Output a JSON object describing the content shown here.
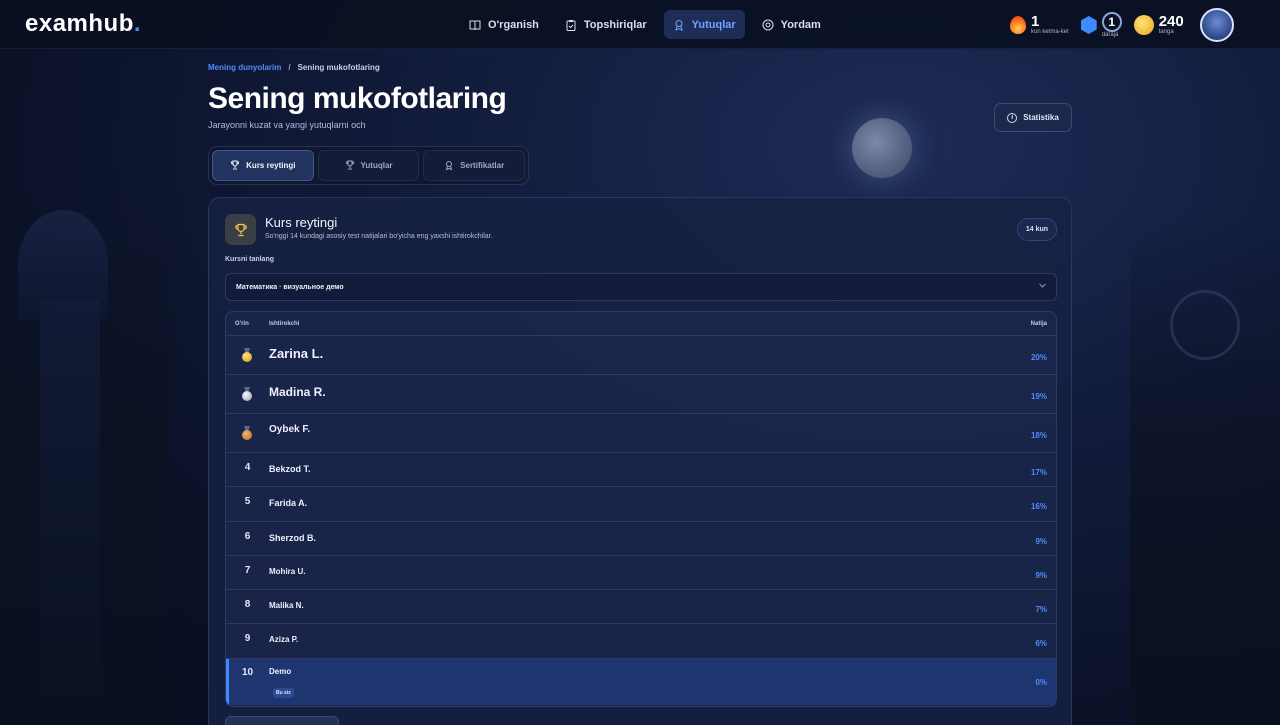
{
  "brand": {
    "logo": "examhub",
    "logo_dot": "."
  },
  "nav": [
    {
      "label": "O'rganish",
      "icon": "book-icon"
    },
    {
      "label": "Topshiriqlar",
      "icon": "clipboard-icon"
    },
    {
      "label": "Yutuqlar",
      "icon": "award-icon",
      "active": true
    },
    {
      "label": "Yordam",
      "icon": "help-icon"
    }
  ],
  "stats": {
    "streak_value": "1",
    "streak_label": "kun ketma-ket",
    "level_value": "1",
    "level_label": "daraja",
    "coins_value": "240",
    "coins_label": "tanga"
  },
  "breadcrumb": {
    "parent": "Mening dunyolarim",
    "separator": "/",
    "current": "Sening mukofotlaring"
  },
  "page": {
    "title": "Sening mukofotlaring",
    "subtitle": "Jarayonni kuzat va yangi yutuqlarni och",
    "stats_button": "Statistika"
  },
  "tabs": [
    {
      "label": "Kurs reytingi",
      "active": true
    },
    {
      "label": "Yutuqlar"
    },
    {
      "label": "Sertifikatlar"
    }
  ],
  "card": {
    "title": "Kurs reytingi",
    "subtitle": "So'nggi 14 kundagi asosiy test natijalari bo'yicha eng yaxshi ishtirokchilar.",
    "period_badge": "14 kun",
    "select_label": "Kursni tanlang",
    "select_value": "Математика · визуальное демо"
  },
  "table": {
    "headers": {
      "rank": "O'rin",
      "name": "Ishtirokchi",
      "result": "Natija"
    },
    "rows": [
      {
        "rank": "1",
        "name": "Zarina L.",
        "result": "20%"
      },
      {
        "rank": "2",
        "name": "Madina R.",
        "result": "19%"
      },
      {
        "rank": "3",
        "name": "Oybek F.",
        "result": "18%"
      },
      {
        "rank": "4",
        "name": "Bekzod T.",
        "result": "17%"
      },
      {
        "rank": "5",
        "name": "Farida A.",
        "result": "16%"
      },
      {
        "rank": "6",
        "name": "Sherzod B.",
        "result": "9%"
      },
      {
        "rank": "7",
        "name": "Mohira U.",
        "result": "9%"
      },
      {
        "rank": "8",
        "name": "Malika N.",
        "result": "7%"
      },
      {
        "rank": "9",
        "name": "Aziza P.",
        "result": "6%"
      },
      {
        "rank": "10",
        "name": "Demo",
        "result": "0%",
        "badge": "Bu siz"
      }
    ]
  },
  "colors": {
    "accent": "#3d8bff",
    "background": "#0b1228",
    "card": "#16213f"
  }
}
